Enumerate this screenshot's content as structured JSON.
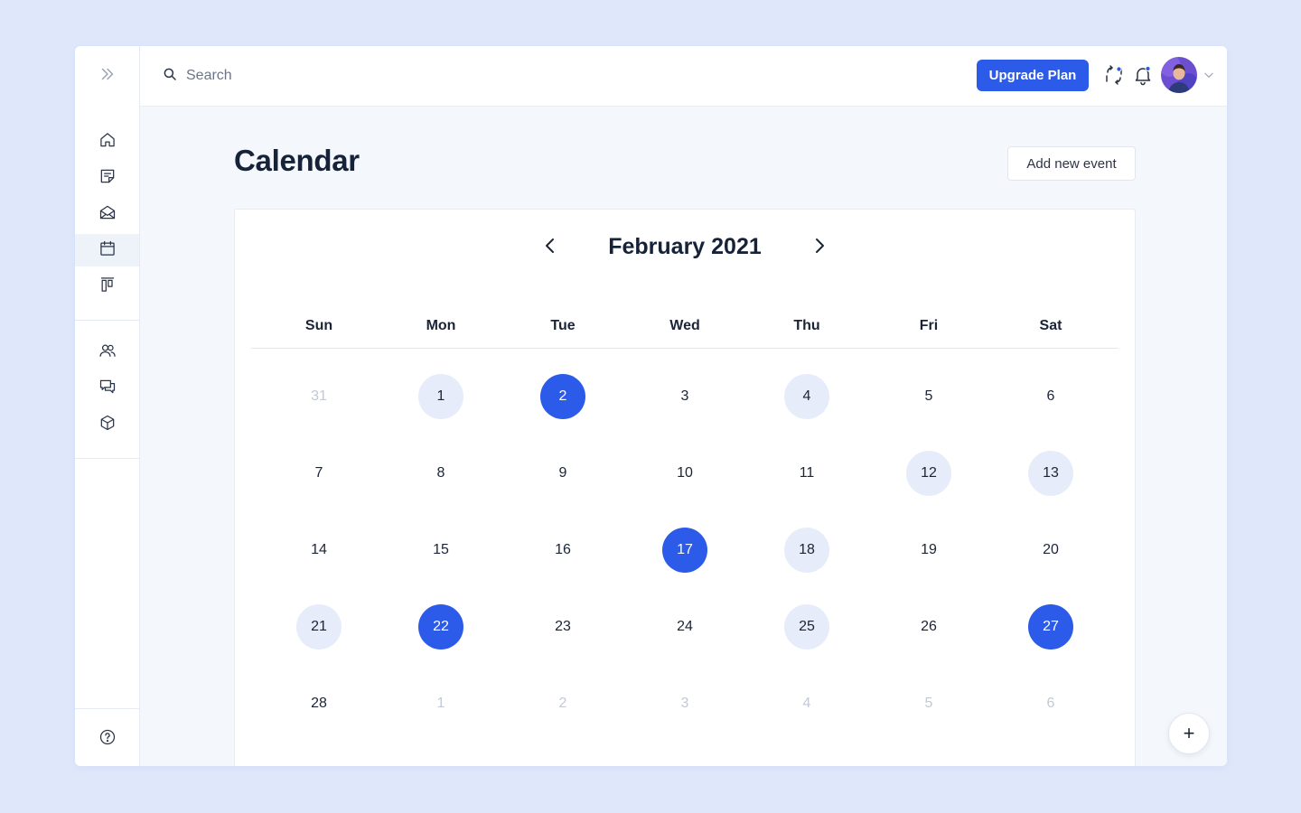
{
  "colors": {
    "accent": "#2c5ae9",
    "accent_light": "#e6ecf9",
    "background": "#dfe8fb",
    "notification_dot": "#2c5ae9"
  },
  "sidebar": {
    "collapse_icon": "double-chevron-right-icon",
    "top_items": [
      {
        "icon": "home-icon"
      },
      {
        "icon": "notes-icon"
      },
      {
        "icon": "mail-icon"
      },
      {
        "icon": "calendar-icon",
        "active": true
      },
      {
        "icon": "board-icon"
      }
    ],
    "middle_items": [
      {
        "icon": "users-icon"
      },
      {
        "icon": "chat-icon"
      },
      {
        "icon": "cube-icon"
      }
    ],
    "bottom_items": [
      {
        "icon": "help-icon"
      }
    ]
  },
  "topbar": {
    "search": {
      "placeholder": "Search",
      "value": "",
      "icon": "search-icon"
    },
    "upgrade_label": "Upgrade Plan",
    "icons": [
      "sync-icon",
      "bell-icon"
    ],
    "avatar": "avatar",
    "menu_icon": "chevron-down-icon"
  },
  "page": {
    "title": "Calendar",
    "add_event_label": "Add new event",
    "fab_label": "+"
  },
  "calendar": {
    "month_label": "February 2021",
    "weekdays": [
      "Sun",
      "Mon",
      "Tue",
      "Wed",
      "Thu",
      "Fri",
      "Sat"
    ],
    "weeks": [
      [
        {
          "d": "31",
          "s": "muted"
        },
        {
          "d": "1",
          "s": "light"
        },
        {
          "d": "2",
          "s": "strong"
        },
        {
          "d": "3",
          "s": ""
        },
        {
          "d": "4",
          "s": "light"
        },
        {
          "d": "5",
          "s": ""
        },
        {
          "d": "6",
          "s": ""
        }
      ],
      [
        {
          "d": "7",
          "s": ""
        },
        {
          "d": "8",
          "s": ""
        },
        {
          "d": "9",
          "s": ""
        },
        {
          "d": "10",
          "s": ""
        },
        {
          "d": "11",
          "s": ""
        },
        {
          "d": "12",
          "s": "light"
        },
        {
          "d": "13",
          "s": "light"
        }
      ],
      [
        {
          "d": "14",
          "s": ""
        },
        {
          "d": "15",
          "s": ""
        },
        {
          "d": "16",
          "s": ""
        },
        {
          "d": "17",
          "s": "strong"
        },
        {
          "d": "18",
          "s": "light"
        },
        {
          "d": "19",
          "s": ""
        },
        {
          "d": "20",
          "s": ""
        }
      ],
      [
        {
          "d": "21",
          "s": "light"
        },
        {
          "d": "22",
          "s": "strong"
        },
        {
          "d": "23",
          "s": ""
        },
        {
          "d": "24",
          "s": ""
        },
        {
          "d": "25",
          "s": "light"
        },
        {
          "d": "26",
          "s": ""
        },
        {
          "d": "27",
          "s": "strong"
        }
      ],
      [
        {
          "d": "28",
          "s": ""
        },
        {
          "d": "1",
          "s": "muted"
        },
        {
          "d": "2",
          "s": "muted"
        },
        {
          "d": "3",
          "s": "muted"
        },
        {
          "d": "4",
          "s": "muted"
        },
        {
          "d": "5",
          "s": "muted"
        },
        {
          "d": "6",
          "s": "muted"
        }
      ]
    ]
  }
}
